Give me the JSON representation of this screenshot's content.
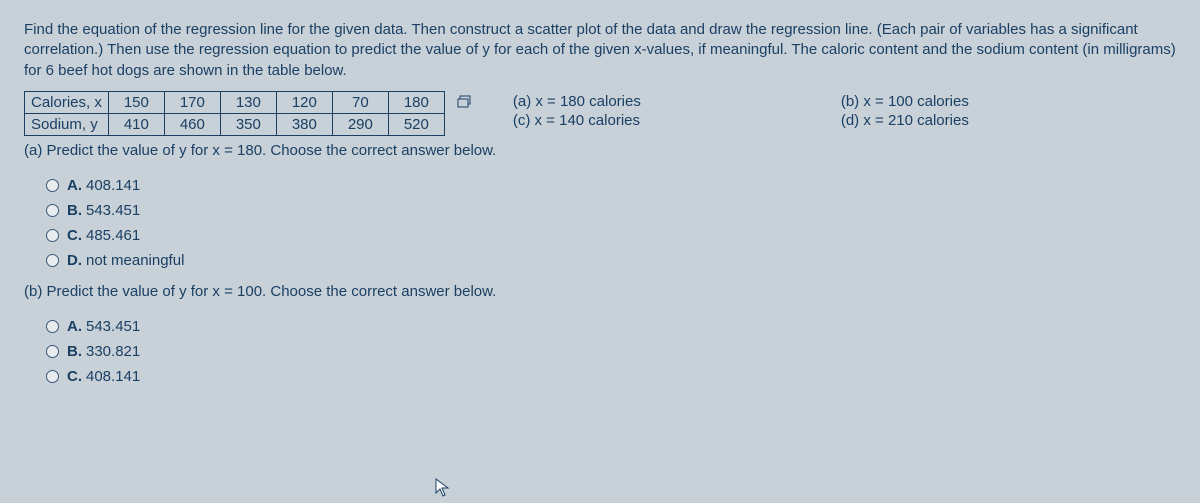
{
  "intro": "Find the equation of the regression line for the given data. Then construct a scatter plot of the data and draw the regression line. (Each pair of variables has a significant correlation.) Then use the regression equation to predict the value of y for each of the given x-values, if meaningful. The caloric content and the sodium content (in milligrams) for 6 beef hot dogs are shown in the table below.",
  "table": {
    "row1label": "Calories, x",
    "row2label": "Sodium, y",
    "row1": [
      "150",
      "170",
      "130",
      "120",
      "70",
      "180"
    ],
    "row2": [
      "410",
      "460",
      "350",
      "380",
      "290",
      "520"
    ]
  },
  "xgiven": {
    "a": "(a) x = 180 calories",
    "b": "(b) x = 100 calories",
    "c": "(c) x = 140 calories",
    "d": "(d) x = 210 calories"
  },
  "qA": {
    "prompt": "(a) Predict the value of y for x = 180. Choose the correct answer below.",
    "options": [
      {
        "letter": "A.",
        "text": "408.141"
      },
      {
        "letter": "B.",
        "text": "543.451"
      },
      {
        "letter": "C.",
        "text": "485.461"
      },
      {
        "letter": "D.",
        "text": "not meaningful"
      }
    ]
  },
  "qB": {
    "prompt": "(b) Predict the value of y for x = 100. Choose the correct answer below.",
    "options": [
      {
        "letter": "A.",
        "text": "543.451"
      },
      {
        "letter": "B.",
        "text": "330.821"
      },
      {
        "letter": "C.",
        "text": "408.141"
      }
    ]
  }
}
